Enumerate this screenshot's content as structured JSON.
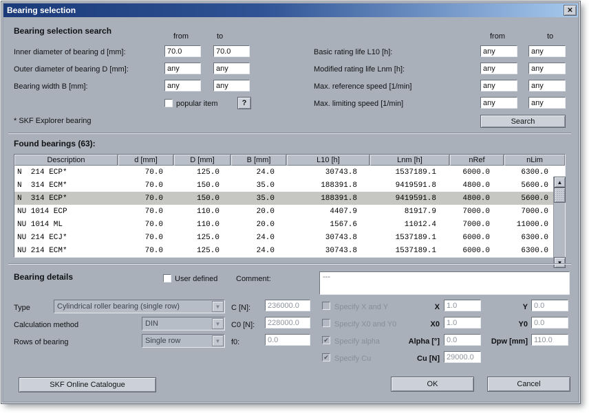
{
  "colors": {
    "titlebar_left": "#1b3a7a",
    "titlebar_mid": "#2f5394",
    "titlebar_right": "#a6c9ee",
    "dialog_bg": "#a9b0ba",
    "panel_light": "#ccd1d9",
    "selected_row": "#c6c7c3",
    "disabled_text": "#878e98",
    "table_bg": "#ffffff"
  },
  "window": {
    "title": "Bearing selection"
  },
  "icons": {
    "close_glyph": "✕",
    "help_glyph": "?",
    "check_glyph": "✔",
    "combo_arrow_glyph": "▼",
    "scroll_up_glyph": "▲",
    "scroll_down_glyph": "▼"
  },
  "search": {
    "heading": "Bearing selection search",
    "col_from": "from",
    "col_to": "to",
    "left_rows": [
      {
        "label": "Inner diameter of bearing d [mm]:",
        "from": "70.0",
        "to": "70.0"
      },
      {
        "label": "Outer diameter of bearing D [mm]:",
        "from": "any",
        "to": "any"
      },
      {
        "label": "Bearing width B [mm]:",
        "from": "any",
        "to": "any"
      }
    ],
    "popular_item_label": "popular item",
    "explorer_note": "* SKF Explorer bearing",
    "right_rows": [
      {
        "label": "Basic rating life L10 [h]:",
        "from": "any",
        "to": "any"
      },
      {
        "label": "Modified rating life Lnm [h]:",
        "from": "any",
        "to": "any"
      },
      {
        "label": "Max. reference speed [1/min]",
        "from": "any",
        "to": "any"
      },
      {
        "label": "Max. limiting speed [1/min]",
        "from": "any",
        "to": "any"
      }
    ],
    "search_button": "Search"
  },
  "results": {
    "heading": "Found bearings (63):",
    "columns": [
      "Description",
      "d [mm]",
      "D [mm]",
      "B [mm]",
      "L10 [h]",
      "Lnm [h]",
      "nRef",
      "nLim"
    ],
    "rows": [
      {
        "cells": [
          "N  214 ECP*",
          "70.0",
          "125.0",
          "24.0",
          "30743.8",
          "1537189.1",
          "6000.0",
          "6300.0"
        ],
        "selected": false
      },
      {
        "cells": [
          "N  314 ECM*",
          "70.0",
          "150.0",
          "35.0",
          "188391.8",
          "9419591.8",
          "4800.0",
          "5600.0"
        ],
        "selected": false
      },
      {
        "cells": [
          "N  314 ECP*",
          "70.0",
          "150.0",
          "35.0",
          "188391.8",
          "9419591.8",
          "4800.0",
          "5600.0"
        ],
        "selected": true
      },
      {
        "cells": [
          "NU 1014 ECP",
          "70.0",
          "110.0",
          "20.0",
          "4407.9",
          "81917.9",
          "7000.0",
          "7000.0"
        ],
        "selected": false
      },
      {
        "cells": [
          "NU 1014 ML",
          "70.0",
          "110.0",
          "20.0",
          "1567.6",
          "11012.4",
          "7000.0",
          "11000.0"
        ],
        "selected": false
      },
      {
        "cells": [
          "NU 214 ECJ*",
          "70.0",
          "125.0",
          "24.0",
          "30743.8",
          "1537189.1",
          "6000.0",
          "6300.0"
        ],
        "selected": false
      },
      {
        "cells": [
          "NU 214 ECM*",
          "70.0",
          "125.0",
          "24.0",
          "30743.8",
          "1537189.1",
          "6000.0",
          "6300.0"
        ],
        "selected": false
      }
    ]
  },
  "details": {
    "heading": "Bearing details",
    "user_defined_label": "User defined",
    "comment_label": "Comment:",
    "comment_value": "---",
    "type_label": "Type",
    "type_value": "Cylindrical roller bearing (single row)",
    "calc_label": "Calculation method",
    "calc_value": "DIN",
    "rows_label": "Rows of bearing",
    "rows_value": "Single row",
    "c_label": "C [N]:",
    "c_value": "236000.0",
    "c0_label": "C0 [N]:",
    "c0_value": "228000.0",
    "f0_label": "f0:",
    "f0_value": "0.0",
    "spec_xy_label": "Specify X and Y",
    "x_label": "X",
    "x_value": "1.0",
    "y_label": "Y",
    "y_value": "0.0",
    "spec_x0y0_label": "Specify X0 and Y0",
    "x0_label": "X0",
    "x0_value": "1.0",
    "y0_label": "Y0",
    "y0_value": "0.0",
    "spec_alpha_label": "Specify alpha",
    "alpha_label": "Alpha [°]",
    "alpha_value": "0.0",
    "dpw_label": "Dpw [mm]",
    "dpw_value": "110.0",
    "spec_cu_label": "Specify Cu",
    "cu_label": "Cu [N]",
    "cu_value": "29000.0"
  },
  "footer": {
    "catalogue_button": "SKF Online Catalogue",
    "ok_button": "OK",
    "cancel_button": "Cancel"
  }
}
